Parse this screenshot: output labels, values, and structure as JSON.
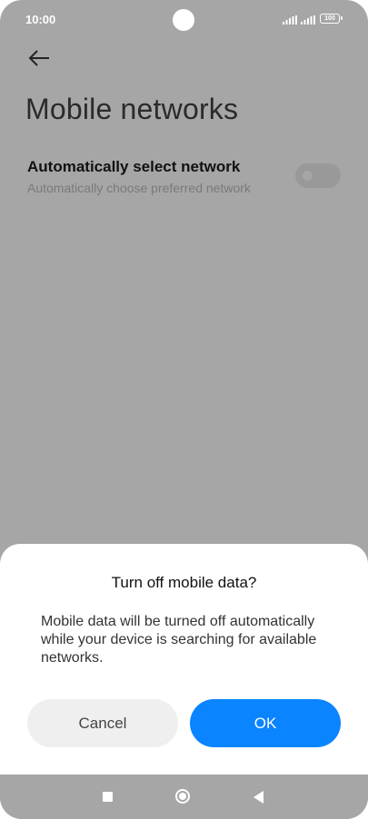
{
  "status_bar": {
    "time": "10:00",
    "battery": "100",
    "icons": [
      "signal-icon",
      "signal-icon",
      "battery-icon"
    ]
  },
  "header": {
    "back_icon": "arrow-left-icon",
    "title": "Mobile networks"
  },
  "settings": {
    "auto_select": {
      "label": "Automatically select network",
      "description": "Automatically choose preferred network",
      "toggle_state": "off"
    }
  },
  "dialog": {
    "title": "Turn off mobile data?",
    "message": "Mobile data will be turned off automatically while your device is searching for available networks.",
    "cancel_label": "Cancel",
    "ok_label": "OK",
    "ok_color": "#0a84ff"
  },
  "nav_bar": {
    "icons": [
      "recents-square-icon",
      "home-circle-icon",
      "back-triangle-icon"
    ]
  }
}
